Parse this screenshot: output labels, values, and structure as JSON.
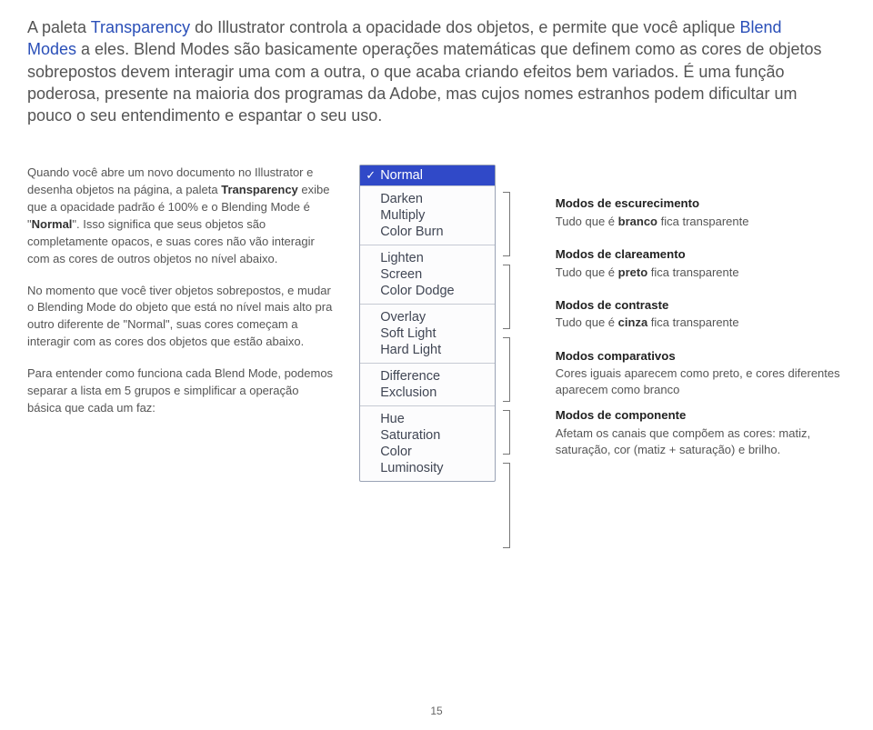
{
  "intro": {
    "part1": "A paleta ",
    "kw1": "Transparency",
    "part2": " do Illustrator controla a opacidade dos objetos, e permite que você aplique ",
    "kw2": "Blend Modes",
    "part3": " a eles. Blend Modes são basicamente operações matemáticas que definem como as cores de objetos sobrepostos devem interagir uma com a outra, o que acaba criando efeitos bem variados. É uma função poderosa, presente na maioria dos programas da Adobe, mas cujos nomes estranhos podem dificultar um pouco o seu entendimento e espantar o seu uso."
  },
  "left": {
    "p1a": "Quando você abre um novo documento no Illustrator e desenha objetos na página, a paleta ",
    "p1b": "Transparency",
    "p1c": " exibe que a opacidade padrão é 100% e o Blending Mode é \"",
    "p1d": "Normal",
    "p1e": "\". Isso significa que seus objetos são completamente opacos, e suas cores não vão interagir com as cores de outros objetos no nível abaixo.",
    "p2": "No momento que você tiver objetos sobrepostos, e mudar o Blending Mode do objeto que está no nível mais alto pra outro diferente de \"Normal\", suas cores começam a interagir com as cores dos objetos que estão abaixo.",
    "p3": "Para entender como funciona cada Blend Mode, podemos separar a lista em 5 grupos e simplificar a operação básica que cada um faz:"
  },
  "dropdown": {
    "selected": "Normal",
    "groups": [
      [
        "Darken",
        "Multiply",
        "Color Burn"
      ],
      [
        "Lighten",
        "Screen",
        "Color Dodge"
      ],
      [
        "Overlay",
        "Soft Light",
        "Hard Light"
      ],
      [
        "Difference",
        "Exclusion"
      ],
      [
        "Hue",
        "Saturation",
        "Color",
        "Luminosity"
      ]
    ]
  },
  "groups_desc": [
    {
      "h": "Modos de escurecimento",
      "pre": "Tudo que é ",
      "b": "branco",
      "post": " fica transparente"
    },
    {
      "h": "Modos de clareamento",
      "pre": "Tudo que é ",
      "b": "preto",
      "post": " fica transparente"
    },
    {
      "h": "Modos de contraste",
      "pre": "Tudo que é ",
      "b": "cinza",
      "post": " fica transparente"
    },
    {
      "h": "Modos comparativos",
      "pre": "Cores iguais aparecem como preto, e cores diferentes aparecem como branco",
      "b": "",
      "post": ""
    },
    {
      "h": "Modos de componente",
      "pre": "Afetam os canais que compõem as cores: matiz, saturação, cor (matiz + saturação) e brilho.",
      "b": "",
      "post": ""
    }
  ],
  "pagenum": "15"
}
